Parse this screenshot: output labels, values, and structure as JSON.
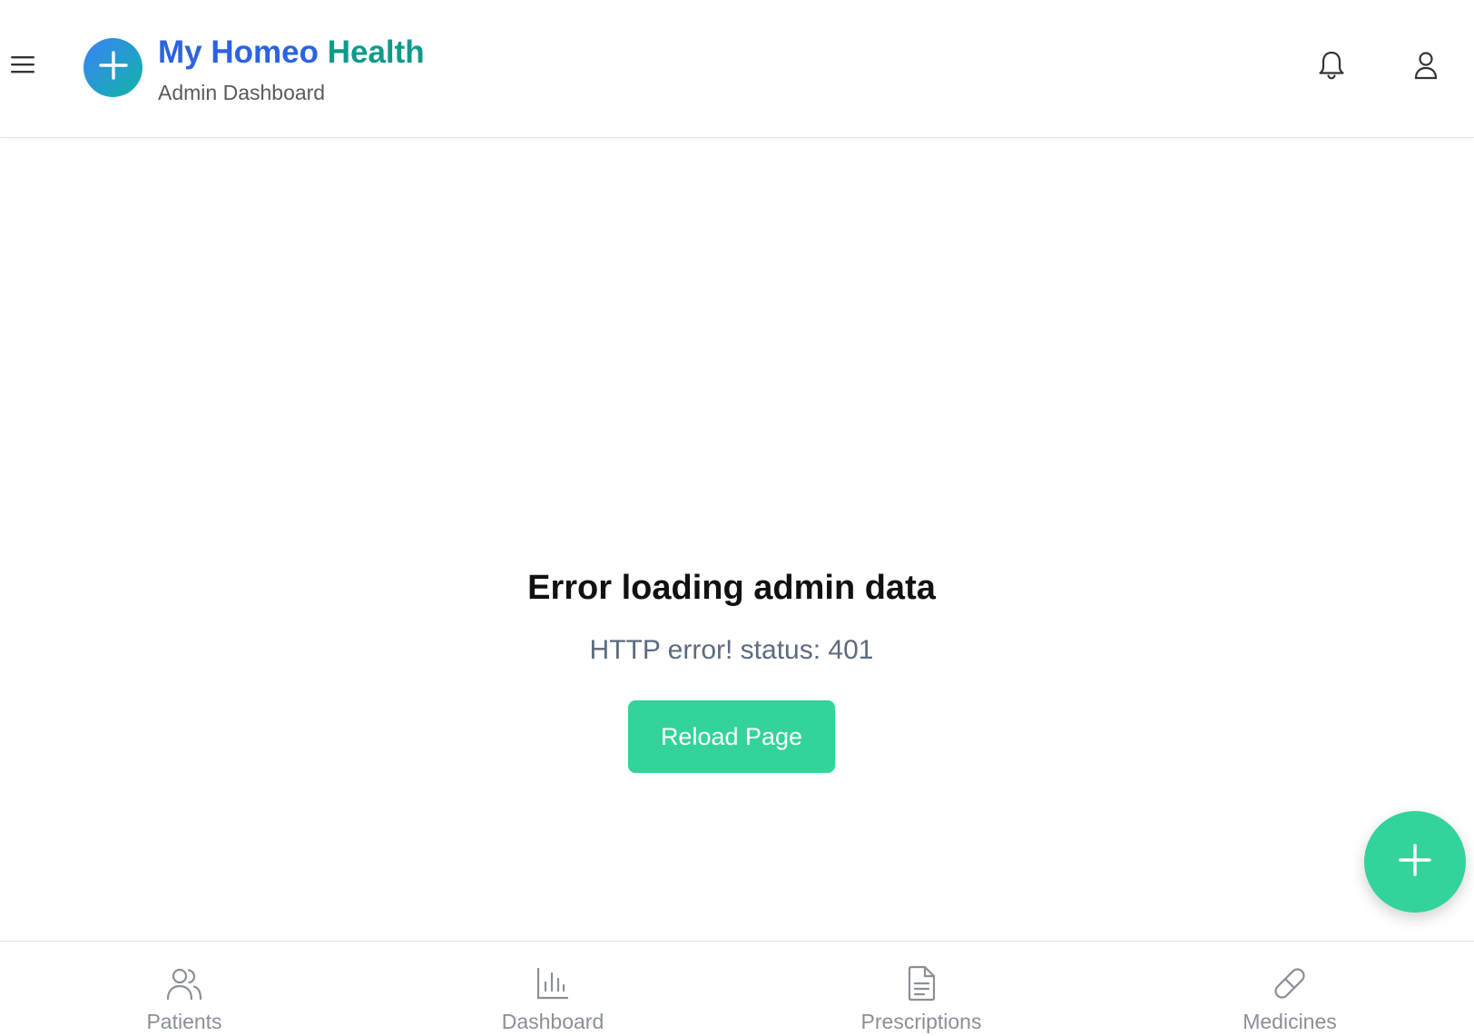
{
  "header": {
    "menu_icon": "hamburger-menu-icon",
    "logo_icon": "plus-icon",
    "brand_primary": "My Homeo",
    "brand_secondary": "Health",
    "subtitle": "Admin Dashboard",
    "notification_icon": "bell-icon",
    "profile_icon": "user-icon"
  },
  "error": {
    "title": "Error loading admin data",
    "message": "HTTP error! status: 401",
    "reload_label": "Reload Page"
  },
  "fab": {
    "icon": "plus-icon"
  },
  "bottom_nav": {
    "items": [
      {
        "label": "Patients",
        "icon": "users-icon"
      },
      {
        "label": "Dashboard",
        "icon": "bar-chart-icon"
      },
      {
        "label": "Prescriptions",
        "icon": "document-icon"
      },
      {
        "label": "Medicines",
        "icon": "pill-icon"
      }
    ]
  },
  "colors": {
    "brand_blue": "#2b63e0",
    "brand_teal": "#0e9a8a",
    "accent_green": "#34d399",
    "muted_text": "#5d6b7e",
    "nav_text": "#8a8f98"
  }
}
